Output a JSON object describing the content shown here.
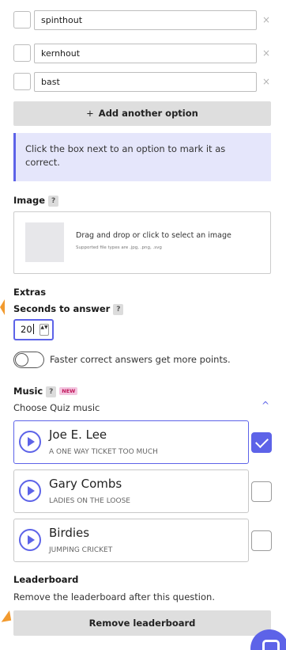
{
  "options": [
    {
      "value": "spinthout"
    },
    {
      "value": "kernhout"
    },
    {
      "value": "bast"
    }
  ],
  "remove_glyph": "×",
  "add_option": {
    "plus": "+",
    "label": "Add another option"
  },
  "info": {
    "text": "Click the box next to an option to mark it as correct."
  },
  "image": {
    "label": "Image",
    "help": "?",
    "dropzone_text": "Drag and drop or click to select an image",
    "dropzone_sub": "Supported file types are .jpg, .png, .svg"
  },
  "extras": {
    "label": "Extras",
    "seconds_label": "Seconds to answer",
    "seconds_help": "?",
    "seconds_value": "20",
    "spin_glyph": "▲▼",
    "toggle_label": "Faster correct answers get more points.",
    "toggle_on": false
  },
  "music": {
    "label": "Music",
    "help": "?",
    "badge": "NEW",
    "subtitle": "Choose Quiz music",
    "chevron": "^",
    "tracks": [
      {
        "title": "Joe E. Lee",
        "artist": "A ONE WAY TICKET TOO MUCH",
        "selected": true
      },
      {
        "title": "Gary Combs",
        "artist": "LADIES ON THE LOOSE",
        "selected": false
      },
      {
        "title": "Birdies",
        "artist": "JUMPING CRICKET",
        "selected": false
      }
    ]
  },
  "leaderboard": {
    "label": "Leaderboard",
    "description": "Remove the leaderboard after this question.",
    "button": "Remove leaderboard"
  },
  "colors": {
    "accent": "#5d63e8",
    "info_bg": "#e5e6fb",
    "button_bg": "#dedede",
    "marker": "#f29a2e"
  },
  "icons": {
    "play": "play-icon",
    "check": "checkmark-icon",
    "chat": "chat-icon",
    "chevron": "chevron-up-icon"
  }
}
